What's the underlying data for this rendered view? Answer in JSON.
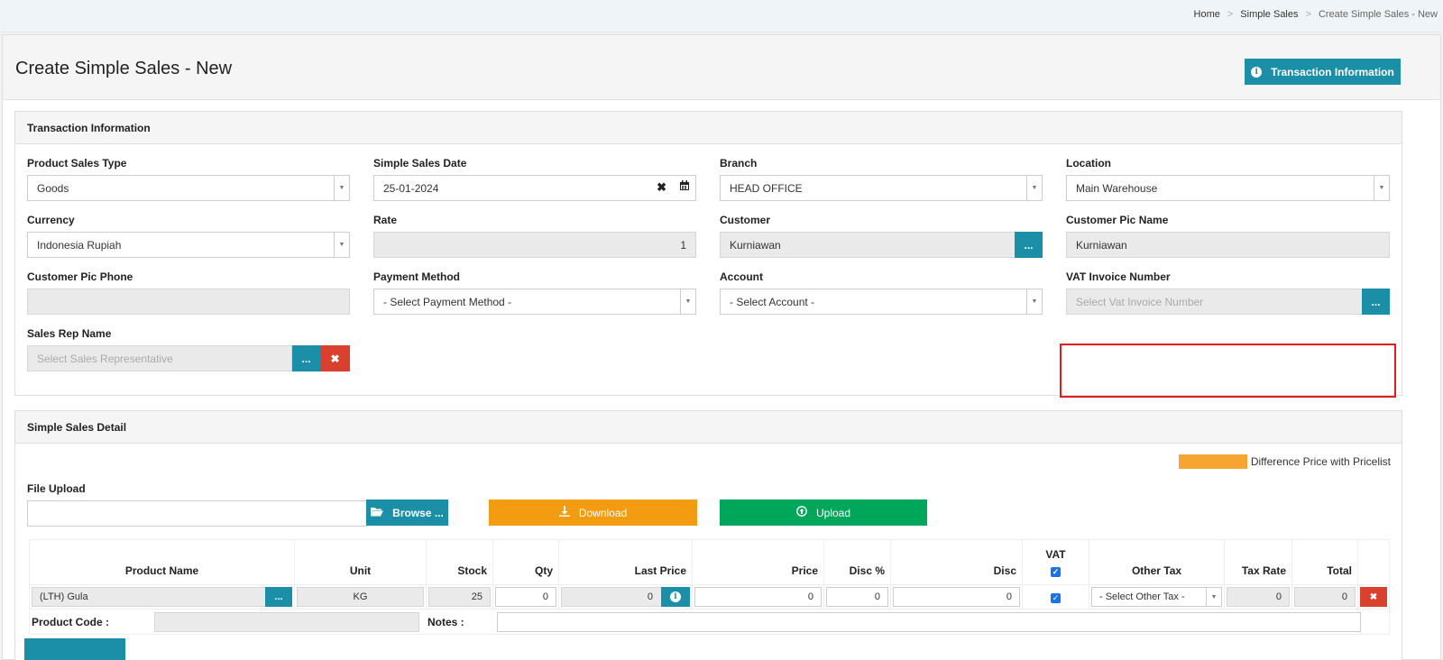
{
  "breadcrumb": {
    "home": "Home",
    "section": "Simple Sales",
    "current": "Create Simple Sales - New",
    "sep": ">"
  },
  "page": {
    "title": "Create Simple Sales - New",
    "info_button": "Transaction Information"
  },
  "transaction": {
    "heading": "Transaction Information",
    "product_sales_type": {
      "label": "Product Sales Type",
      "value": "Goods"
    },
    "simple_sales_date": {
      "label": "Simple Sales Date",
      "value": "25-01-2024"
    },
    "branch": {
      "label": "Branch",
      "value": "HEAD OFFICE"
    },
    "location": {
      "label": "Location",
      "value": "Main Warehouse"
    },
    "currency": {
      "label": "Currency",
      "value": "Indonesia Rupiah"
    },
    "rate": {
      "label": "Rate",
      "value": "1"
    },
    "customer": {
      "label": "Customer",
      "value": "Kurniawan",
      "lookup": "..."
    },
    "customer_pic_name": {
      "label": "Customer Pic Name",
      "value": "Kurniawan"
    },
    "customer_pic_phone": {
      "label": "Customer Pic Phone",
      "value": ""
    },
    "payment_method": {
      "label": "Payment Method",
      "value": "- Select Payment Method -"
    },
    "account": {
      "label": "Account",
      "value": "- Select Account -"
    },
    "vat_invoice": {
      "label": "VAT Invoice Number",
      "placeholder": "Select Vat Invoice Number",
      "lookup": "..."
    },
    "sales_rep": {
      "label": "Sales Rep Name",
      "placeholder": "Select Sales Representative",
      "lookup": "...",
      "clear": "✖"
    }
  },
  "detail": {
    "heading": "Simple Sales Detail",
    "legend": {
      "label": "Difference Price with Pricelist",
      "color": "#f7a532"
    },
    "file_upload": {
      "label": "File Upload",
      "browse": "Browse ...",
      "download": "Download",
      "upload": "Upload"
    },
    "columns": [
      "Product Name",
      "Unit",
      "Stock",
      "Qty",
      "Last Price",
      "Price",
      "Disc %",
      "Disc",
      "VAT",
      "Other Tax",
      "Tax Rate",
      "Total"
    ],
    "row": {
      "product": "(LTH) Gula",
      "lookup": "...",
      "unit": "KG",
      "stock": "25",
      "qty": "0",
      "last_price": "0",
      "price": "0",
      "disc_pct": "0",
      "disc": "0",
      "vat_checked": true,
      "other_tax": "- Select Other Tax -",
      "tax_rate": "0",
      "total": "0",
      "delete": "✖"
    },
    "product_code_label": "Product Code :",
    "notes_label": "Notes :"
  },
  "colors": {
    "primary": "#1a8fa7",
    "danger": "#d9412e",
    "warning": "#f39c12",
    "success": "#00a65a",
    "highlight": "#e51b1b"
  }
}
